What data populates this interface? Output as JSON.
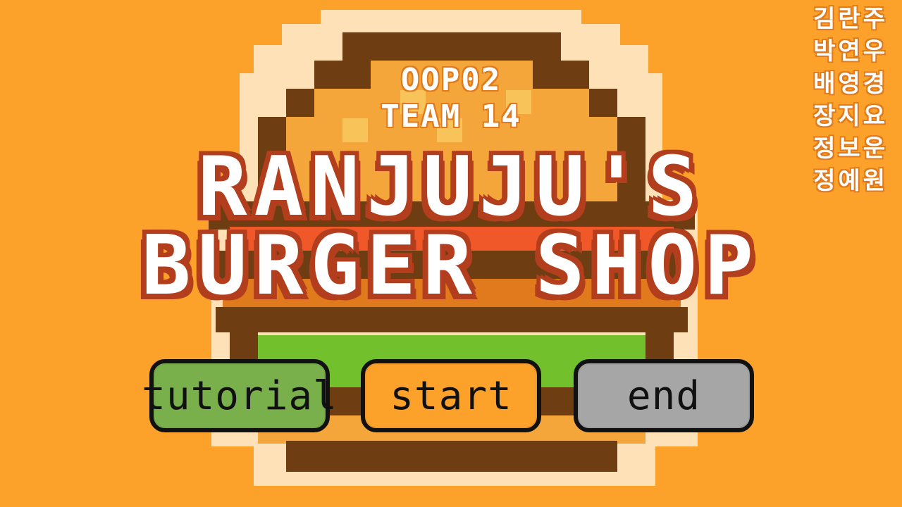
{
  "team": {
    "course": "OOP02",
    "team_name": "TEAM 14"
  },
  "title": {
    "line1": "RANJUJU'S",
    "line2": "BURGER SHOP"
  },
  "menu": {
    "buttons": [
      {
        "label": "tutorial",
        "color": "#7ab04c"
      },
      {
        "label": "start",
        "color": "#fca12a"
      },
      {
        "label": "end",
        "color": "#a6a6a6"
      }
    ]
  },
  "credits": [
    "김란주",
    "박연우",
    "배영경",
    "장지요",
    "정보운",
    "정예원"
  ],
  "colors": {
    "background": "#fca12a",
    "title_outline": "#b23e1e",
    "bun": "#f5a63b",
    "bun_outline": "#6e3d12",
    "lettuce": "#72c02c",
    "sauce": "#f0582a",
    "halo": "#ffe1b8"
  }
}
